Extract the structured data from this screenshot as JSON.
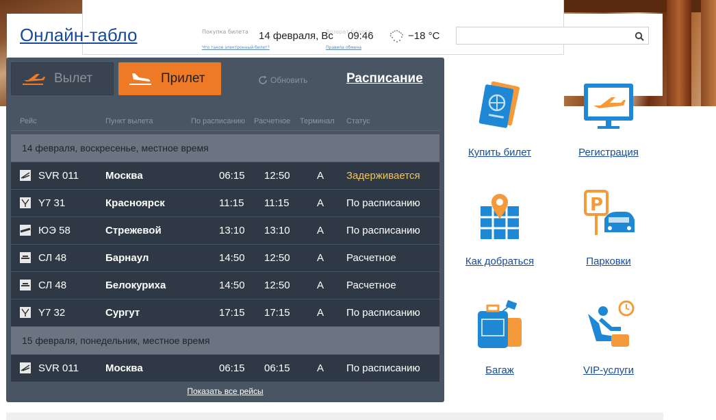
{
  "header": {
    "title": "Онлайн-табло",
    "date": "14 февраля, Вс",
    "time": "09:46",
    "temperature": "−18 °C",
    "weather_icon": "snow-cloud-icon",
    "search_placeholder": ""
  },
  "ad": {
    "text1": "Покупка билета",
    "text2": "Что такое электронный билет?",
    "text3": "Возврат билета",
    "text4": "Правила обмена"
  },
  "board": {
    "tab_departure": "Вылет",
    "tab_arrival": "Прилет",
    "refresh": "Обновить",
    "schedule": "Расписание",
    "columns": [
      "Рейс",
      "Пункт вылета",
      "По расписанию",
      "Расчетное",
      "Терминал",
      "Статус"
    ],
    "groups": [
      {
        "date": "14 февраля, воскресенье, местное время",
        "rows": [
          {
            "flight": "SVR 011",
            "city": "Москва",
            "sched": "06:15",
            "est": "12:50",
            "term": "A",
            "status": "Задерживается",
            "delayed": true
          },
          {
            "flight": "Y7 31",
            "city": "Красноярск",
            "sched": "11:15",
            "est": "11:15",
            "term": "A",
            "status": "По расписанию",
            "delayed": false
          },
          {
            "flight": "ЮЭ 58",
            "city": "Стрежевой",
            "sched": "13:10",
            "est": "13:10",
            "term": "A",
            "status": "По расписанию",
            "delayed": false
          },
          {
            "flight": "СЛ 48",
            "city": "Барнаул",
            "sched": "14:50",
            "est": "12:50",
            "term": "A",
            "status": "Расчетное",
            "delayed": false
          },
          {
            "flight": "СЛ 48",
            "city": "Белокуриха",
            "sched": "14:50",
            "est": "12:50",
            "term": "A",
            "status": "Расчетное",
            "delayed": false
          },
          {
            "flight": "Y7 32",
            "city": "Сургут",
            "sched": "17:15",
            "est": "17:15",
            "term": "A",
            "status": "По расписанию",
            "delayed": false
          }
        ]
      },
      {
        "date": "15 февраля, понедельник, местное время",
        "rows": [
          {
            "flight": "SVR 011",
            "city": "Москва",
            "sched": "06:15",
            "est": "06:15",
            "term": "A",
            "status": "По расписанию",
            "delayed": false
          }
        ]
      }
    ],
    "show_all": "Показать все рейсы"
  },
  "services": [
    {
      "label": "Купить билет",
      "icon": "ticket-passport-icon"
    },
    {
      "label": "Регистрация",
      "icon": "checkin-monitor-icon"
    },
    {
      "label": "Как добраться",
      "icon": "map-pin-icon"
    },
    {
      "label": "Парковки",
      "icon": "parking-car-icon"
    },
    {
      "label": "Багаж",
      "icon": "luggage-icon"
    },
    {
      "label": "VIP-услуги",
      "icon": "vip-lounge-icon"
    }
  ],
  "colors": {
    "accent": "#ef7a25",
    "link": "#174a9a",
    "board_bg": "#4a5563",
    "row_bg": "#2f3945",
    "delay": "#f2c55c",
    "icon_blue": "#1e88d4"
  }
}
